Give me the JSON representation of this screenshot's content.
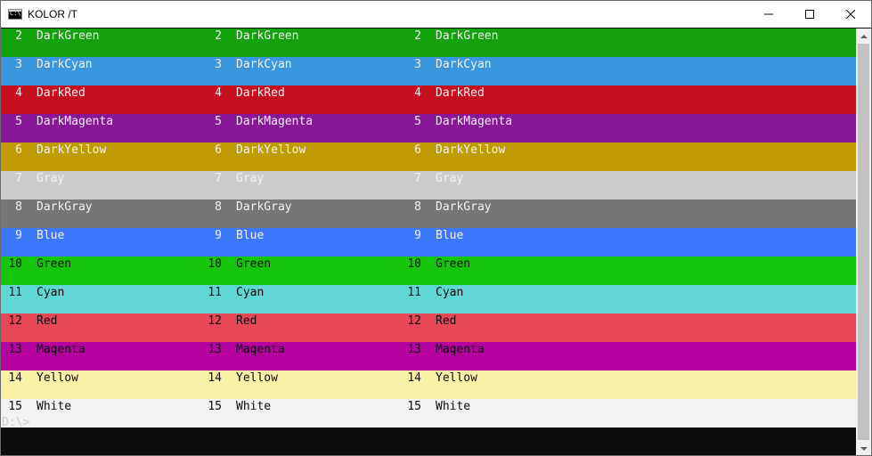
{
  "window": {
    "title": "KOLOR /T",
    "icon": "console-icon"
  },
  "caption_buttons": [
    {
      "name": "minimize-button",
      "icon": "minimize-icon"
    },
    {
      "name": "maximize-button",
      "icon": "maximize-icon"
    },
    {
      "name": "close-button",
      "icon": "close-icon"
    }
  ],
  "rows": [
    {
      "num": "2",
      "name": "DarkGreen",
      "bg": "#13a10e",
      "fg": "#f2f2f2"
    },
    {
      "num": "3",
      "name": "DarkCyan",
      "bg": "#3a96dd",
      "fg": "#f2f2f2"
    },
    {
      "num": "4",
      "name": "DarkRed",
      "bg": "#c50f1f",
      "fg": "#f2f2f2"
    },
    {
      "num": "5",
      "name": "DarkMagenta",
      "bg": "#881798",
      "fg": "#f2f2f2"
    },
    {
      "num": "6",
      "name": "DarkYellow",
      "bg": "#c19c00",
      "fg": "#f2f2f2"
    },
    {
      "num": "7",
      "name": "Gray",
      "bg": "#cccccc",
      "fg": "#f2f2f2"
    },
    {
      "num": "8",
      "name": "DarkGray",
      "bg": "#767676",
      "fg": "#f2f2f2"
    },
    {
      "num": "9",
      "name": "Blue",
      "bg": "#3b78ff",
      "fg": "#f2f2f2"
    },
    {
      "num": "10",
      "name": "Green",
      "bg": "#16c60c",
      "fg": "#0c0c0c"
    },
    {
      "num": "11",
      "name": "Cyan",
      "bg": "#61d6d6",
      "fg": "#0c0c0c"
    },
    {
      "num": "12",
      "name": "Red",
      "bg": "#e74856",
      "fg": "#0c0c0c"
    },
    {
      "num": "13",
      "name": "Magenta",
      "bg": "#b4009e",
      "fg": "#0c0c0c"
    },
    {
      "num": "14",
      "name": "Yellow",
      "bg": "#f9f1a5",
      "fg": "#0c0c0c"
    },
    {
      "num": "15",
      "name": "White",
      "bg": "#f2f2f2",
      "fg": "#0c0c0c"
    }
  ],
  "prompt": "D:\\>"
}
